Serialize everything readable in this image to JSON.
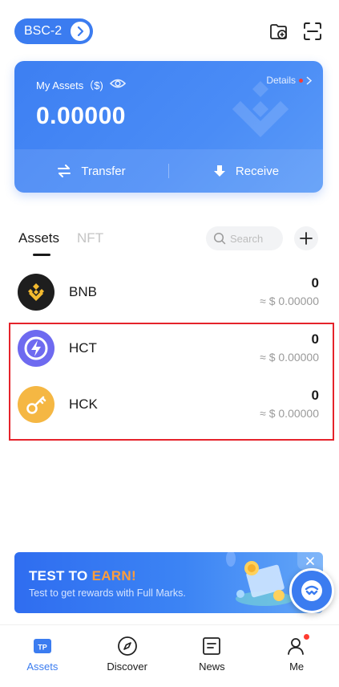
{
  "header": {
    "network": "BSC-2",
    "icons": [
      "wallet-add-icon",
      "scan-icon"
    ]
  },
  "asset_card": {
    "label": "My Assets（$)",
    "eye_icon": "eye-icon",
    "details": "Details",
    "amount": "0.00000",
    "transfer": "Transfer",
    "receive": "Receive"
  },
  "tabs": {
    "assets": "Assets",
    "nft": "NFT",
    "search_placeholder": "Search"
  },
  "tokens": [
    {
      "name": "BNB",
      "balance": "0",
      "fiat": "≈ $ 0.00000",
      "color": "#1e1e1e",
      "icon": "bnb-logo-icon"
    },
    {
      "name": "HCT",
      "balance": "0",
      "fiat": "≈ $ 0.00000",
      "color": "#6e6af0",
      "icon": "hct-logo-icon"
    },
    {
      "name": "HCK",
      "balance": "0",
      "fiat": "≈ $ 0.00000",
      "color": "#f5b743",
      "icon": "hck-logo-icon"
    }
  ],
  "banner": {
    "title_prefix": "TEST TO ",
    "title_highlight": "EARN!",
    "subtitle": "Test to get rewards with Full Marks."
  },
  "bottom_nav": [
    {
      "label": "Assets",
      "icon": "tp-wallet-icon",
      "active": true
    },
    {
      "label": "Discover",
      "icon": "compass-icon",
      "active": false
    },
    {
      "label": "News",
      "icon": "news-icon",
      "active": false
    },
    {
      "label": "Me",
      "icon": "person-icon",
      "active": false
    }
  ],
  "colors": {
    "accent": "#3b7cf0",
    "highlight_box": "#e5232b",
    "earn": "#ff9d3a",
    "badge": "#ff3b30"
  }
}
